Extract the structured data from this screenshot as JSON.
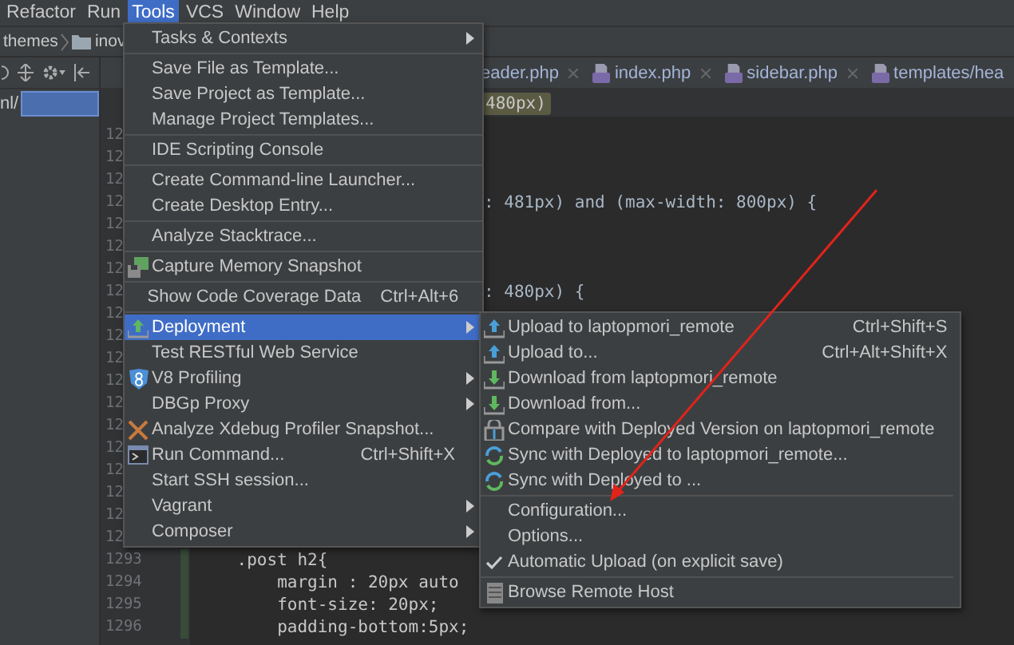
{
  "menubar": [
    {
      "label": "Refactor",
      "selected": false
    },
    {
      "label": "Run",
      "selected": false
    },
    {
      "label": "Tools",
      "selected": true
    },
    {
      "label": "VCS",
      "selected": false
    },
    {
      "label": "Window",
      "selected": false
    },
    {
      "label": "Help",
      "selected": false
    }
  ],
  "breadcrumb": [
    "themes",
    "inov"
  ],
  "project_panel": {
    "path": "nl/"
  },
  "tabs": [
    {
      "label": "eader.php",
      "kind": "cut"
    },
    {
      "label": "index.php",
      "kind": "file"
    },
    {
      "label": "sidebar.php",
      "kind": "file"
    },
    {
      "label": "templates/hea",
      "kind": "file"
    }
  ],
  "editor_breadcrumb": "480px)",
  "lines": [
    {
      "number": "12",
      "kind": "blank"
    },
    {
      "number": "12",
      "kind": "blank"
    },
    {
      "number": "12",
      "kind": "blank"
    },
    {
      "number": "12",
      "kind": "fragment",
      "code": ": 481px) and (max-width: 800px) {"
    },
    {
      "number": "12",
      "kind": "blank"
    },
    {
      "number": "12",
      "kind": "blank"
    },
    {
      "number": "12",
      "kind": "blank"
    },
    {
      "number": "12",
      "kind": "fragment",
      "code": ": 480px) {"
    },
    {
      "number": "12",
      "kind": "blank"
    },
    {
      "number": "12",
      "kind": "blank"
    },
    {
      "number": "12",
      "kind": "blank"
    },
    {
      "number": "12",
      "kind": "blank"
    },
    {
      "number": "12",
      "kind": "blank"
    },
    {
      "number": "12",
      "kind": "blank"
    },
    {
      "number": "12",
      "kind": "blank"
    },
    {
      "number": "12",
      "kind": "blank"
    },
    {
      "number": "12",
      "kind": "blank"
    },
    {
      "number": "12",
      "kind": "blank"
    },
    {
      "number": "12",
      "kind": "blank"
    },
    {
      "number": "1293",
      "kind": "full",
      "code": "    .post h2{"
    },
    {
      "number": "1294",
      "kind": "full",
      "code": "        margin : 20px auto"
    },
    {
      "number": "1295",
      "kind": "full",
      "code": "        font-size: 20px;"
    },
    {
      "number": "1296",
      "kind": "full",
      "code": "        padding-bottom:5px;"
    }
  ],
  "tools_menu": [
    {
      "kind": "item",
      "label": "Tasks & Contexts",
      "submenu": true,
      "selected": false
    },
    {
      "kind": "separator"
    },
    {
      "kind": "item",
      "label": "Save File as Template...",
      "submenu": false,
      "selected": false
    },
    {
      "kind": "item",
      "label": "Save Project as Template...",
      "submenu": false,
      "selected": false
    },
    {
      "kind": "item",
      "label": "Manage Project Templates...",
      "submenu": false,
      "selected": false
    },
    {
      "kind": "separator"
    },
    {
      "kind": "item",
      "label": "IDE Scripting Console",
      "submenu": false,
      "selected": false
    },
    {
      "kind": "separator"
    },
    {
      "kind": "item",
      "label": "Create Command-line Launcher...",
      "submenu": false,
      "selected": false
    },
    {
      "kind": "item",
      "label": "Create Desktop Entry...",
      "submenu": false,
      "selected": false
    },
    {
      "kind": "separator"
    },
    {
      "kind": "item",
      "label": "Analyze Stacktrace...",
      "submenu": false,
      "selected": false
    },
    {
      "kind": "separator"
    },
    {
      "kind": "item",
      "label": "Capture Memory Snapshot",
      "submenu": false,
      "selected": false
    },
    {
      "kind": "separator"
    },
    {
      "kind": "item",
      "label": "Show Code Coverage Data",
      "shortcut": "Ctrl+Alt+6",
      "submenu": false,
      "selected": false
    },
    {
      "kind": "separator"
    },
    {
      "kind": "item",
      "label": "Deployment",
      "submenu": true,
      "selected": true
    },
    {
      "kind": "item",
      "label": "Test RESTful Web Service",
      "submenu": false,
      "selected": false
    },
    {
      "kind": "item",
      "label": "V8 Profiling",
      "submenu": true,
      "selected": false
    },
    {
      "kind": "item",
      "label": "DBGp Proxy",
      "submenu": true,
      "selected": false
    },
    {
      "kind": "item",
      "label": "Analyze Xdebug Profiler Snapshot...",
      "submenu": false,
      "selected": false
    },
    {
      "kind": "item",
      "label": "Run Command...",
      "shortcut": "Ctrl+Shift+X",
      "submenu": false,
      "selected": false
    },
    {
      "kind": "item",
      "label": "Start SSH session...",
      "submenu": false,
      "selected": false
    },
    {
      "kind": "item",
      "label": "Vagrant",
      "submenu": true,
      "selected": false
    },
    {
      "kind": "item",
      "label": "Composer",
      "submenu": true,
      "selected": false
    }
  ],
  "deployment_menu": [
    {
      "kind": "item",
      "label": "Upload to laptopmori_remote",
      "shortcut": "Ctrl+Shift+S",
      "checked": false
    },
    {
      "kind": "item",
      "label": "Upload to...",
      "shortcut": "Ctrl+Alt+Shift+X",
      "checked": false
    },
    {
      "kind": "item",
      "label": "Download from laptopmori_remote",
      "checked": false
    },
    {
      "kind": "item",
      "label": "Download from...",
      "checked": false
    },
    {
      "kind": "item",
      "label": "Compare with Deployed Version on laptopmori_remote",
      "checked": false
    },
    {
      "kind": "item",
      "label": "Sync with Deployed to laptopmori_remote...",
      "checked": false
    },
    {
      "kind": "item",
      "label": "Sync with Deployed to ...",
      "checked": false
    },
    {
      "kind": "separator"
    },
    {
      "kind": "item",
      "label": "Configuration...",
      "checked": false
    },
    {
      "kind": "item",
      "label": "Options...",
      "checked": false
    },
    {
      "kind": "item",
      "label": "Automatic Upload (on explicit save)",
      "checked": true
    },
    {
      "kind": "separator"
    },
    {
      "kind": "item",
      "label": "Browse Remote Host",
      "checked": false
    }
  ]
}
